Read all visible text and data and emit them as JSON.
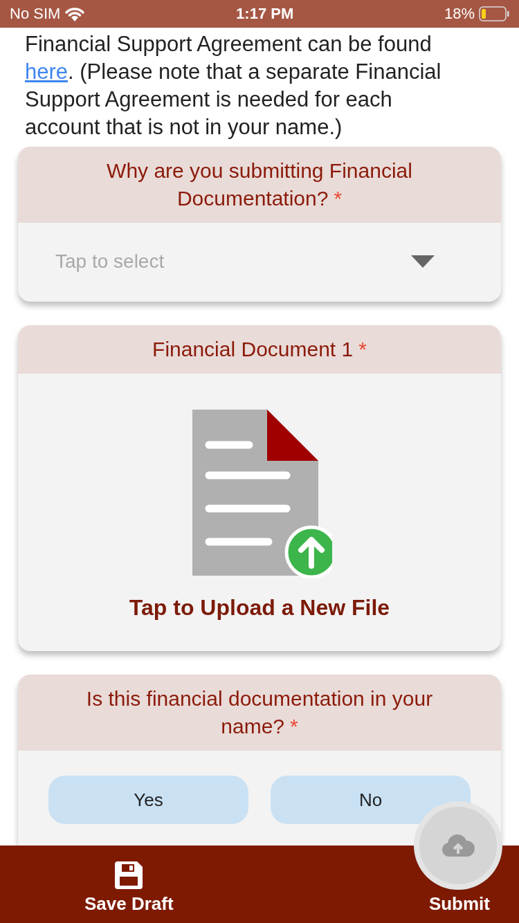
{
  "status_bar": {
    "carrier": "No SIM",
    "time": "1:17 PM",
    "battery": "18%"
  },
  "intro": {
    "text_before": "Financial Support Agreement can be found ",
    "link": "here",
    "text_after": ".  (Please note that a separate Financial Support Agreement is needed for each account that is not in your name.)"
  },
  "questions": [
    {
      "kind": "select",
      "label": "Why are you submitting Financial Documentation?",
      "required_mark": "*",
      "placeholder": "Tap to select"
    },
    {
      "kind": "upload",
      "label": "Financial Document 1",
      "required_mark": "*",
      "action": "Tap to Upload a New File"
    },
    {
      "kind": "choice",
      "label": "Is this financial documentation in your name?",
      "required_mark": "*",
      "options": [
        {
          "label": "Yes",
          "selected": false
        },
        {
          "label": "No",
          "selected": false
        }
      ]
    }
  ],
  "bottom_bar": {
    "save": "Save Draft",
    "submit": "Submit"
  }
}
